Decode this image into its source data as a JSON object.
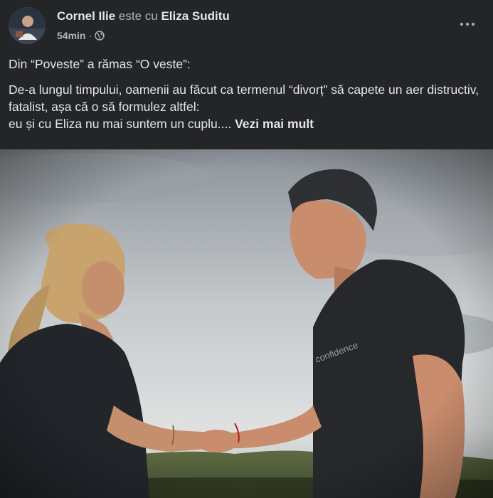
{
  "post": {
    "author": "Cornel Ilie",
    "with_text": "este cu",
    "tagged": "Eliza Suditu",
    "time": "54min",
    "separator": "·",
    "privacy_icon": "globe-icon",
    "more_icon": "more-options-icon",
    "line1": "Din “Poveste” a rămas “O veste”:",
    "line2": "De-a lungul timpului, oamenii au făcut ca termenul “divorț” să capete un aer distructiv, fatalist, așa că o să formulez altfel:",
    "line3": "eu și cu Eliza nu mai suntem un cuplu....",
    "see_more": "Vezi mai mult",
    "shirt_text": "confidence"
  },
  "colors": {
    "background": "#242526",
    "text_primary": "#e4e6eb",
    "text_secondary": "#b0b3b8"
  }
}
